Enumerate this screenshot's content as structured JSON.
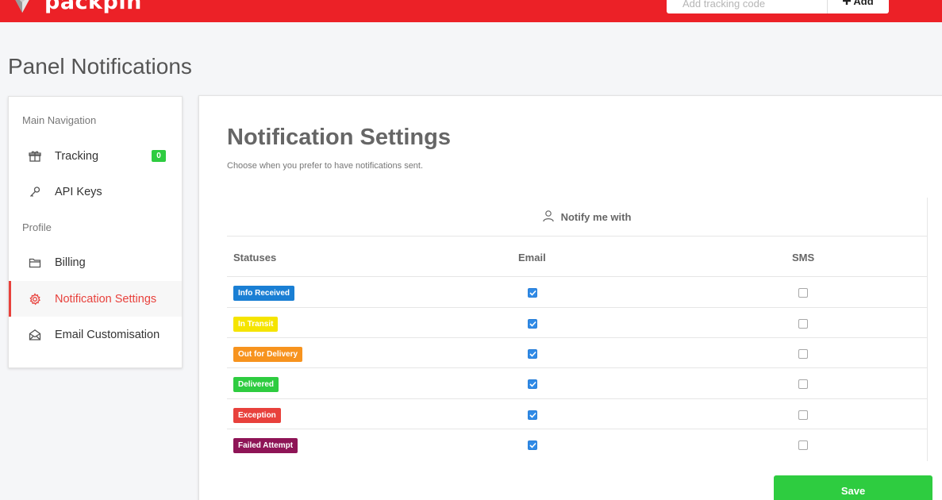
{
  "header": {
    "brand": "packpin",
    "tracking_placeholder": "Add tracking code",
    "add_label": "Add",
    "brand_color": "#ec2127"
  },
  "page": {
    "title": "Panel Notifications"
  },
  "sidebar": {
    "section_main": "Main Navigation",
    "section_profile": "Profile",
    "items": [
      {
        "label": "Tracking",
        "icon": "gift-icon",
        "badge": "0"
      },
      {
        "label": "API Keys",
        "icon": "key-icon"
      },
      {
        "label": "Billing",
        "icon": "folder-icon"
      },
      {
        "label": "Notification Settings",
        "icon": "gear-icon",
        "active": true
      },
      {
        "label": "Email Customisation",
        "icon": "envelope-icon"
      }
    ]
  },
  "main": {
    "title": "Notification Settings",
    "subtitle": "Choose when you prefer to have notifications sent.",
    "notify_header": "Notify me with",
    "columns": {
      "status": "Statuses",
      "email": "Email",
      "sms": "SMS"
    },
    "rows": [
      {
        "status": "Info Received",
        "color": "#1a7fd4",
        "email": true,
        "sms": false
      },
      {
        "status": "In Transit",
        "color": "#f5e400",
        "email": true,
        "sms": false
      },
      {
        "status": "Out for Delivery",
        "color": "#f7931e",
        "email": true,
        "sms": false
      },
      {
        "status": "Delivered",
        "color": "#2ecc40",
        "email": true,
        "sms": false
      },
      {
        "status": "Exception",
        "color": "#e8413c",
        "email": true,
        "sms": false
      },
      {
        "status": "Failed Attempt",
        "color": "#8e1456",
        "email": true,
        "sms": false
      }
    ],
    "save_label": "Save"
  }
}
